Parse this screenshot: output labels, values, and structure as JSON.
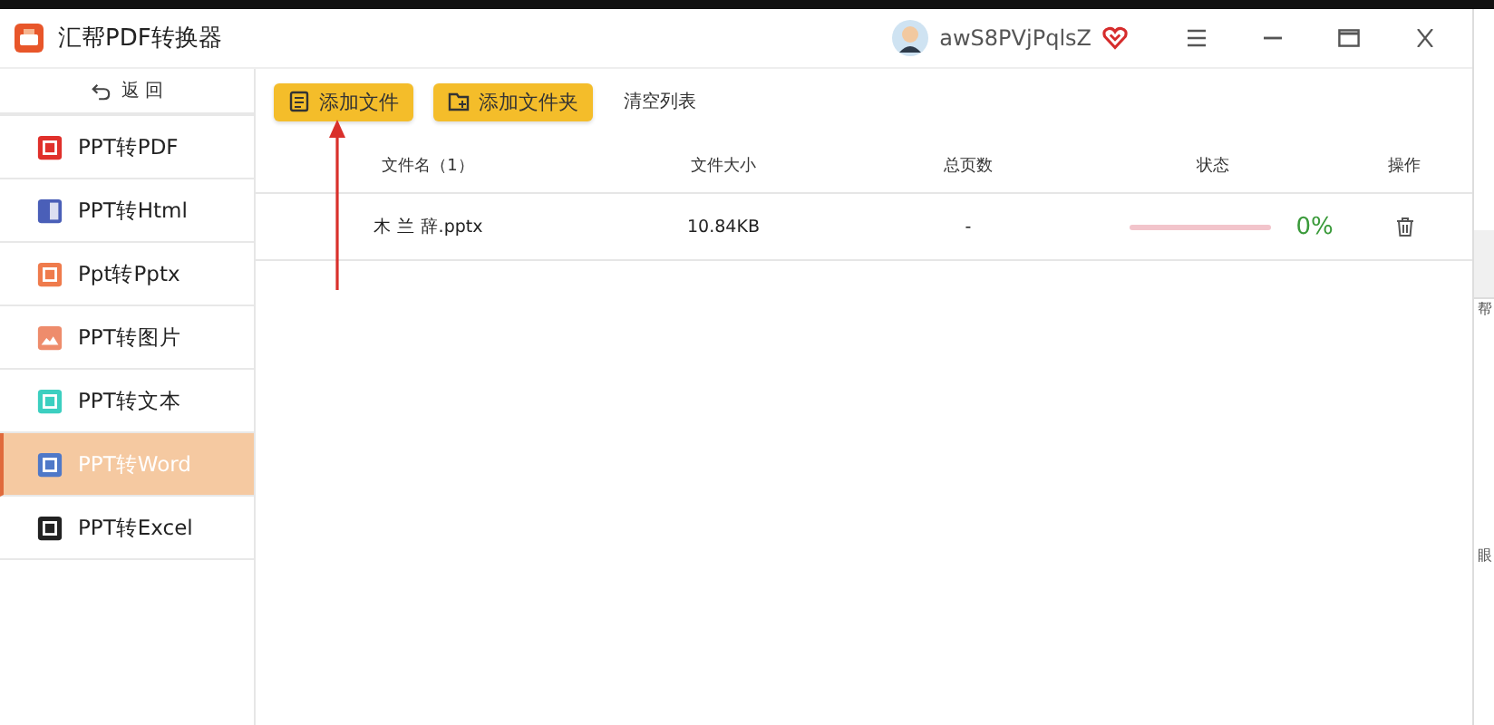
{
  "window": {
    "title": "汇帮PDF转换器",
    "user": "awS8PVjPqlsZ"
  },
  "sidebar": {
    "back": "返 回",
    "items": [
      {
        "label": "PPT转PDF",
        "kind": "pdf",
        "selected": false
      },
      {
        "label": "PPT转Html",
        "kind": "html",
        "selected": false
      },
      {
        "label": "Ppt转Pptx",
        "kind": "pptx",
        "selected": false
      },
      {
        "label": "PPT转图片",
        "kind": "image",
        "selected": false
      },
      {
        "label": "PPT转文本",
        "kind": "text",
        "selected": false
      },
      {
        "label": "PPT转Word",
        "kind": "word",
        "selected": true
      },
      {
        "label": "PPT转Excel",
        "kind": "excel",
        "selected": false
      }
    ]
  },
  "toolbar": {
    "add_file": "添加文件",
    "add_folder": "添加文件夹",
    "clear": "清空列表"
  },
  "table": {
    "columns": [
      "文件名（1）",
      "文件大小",
      "总页数",
      "状态",
      "操作"
    ],
    "rows": [
      {
        "name": "木 兰 辞.pptx",
        "size": "10.84KB",
        "pages": "-",
        "level": 0,
        "percent": "0%"
      }
    ]
  },
  "background_window": {
    "texts": [
      "帮",
      "眼"
    ]
  }
}
